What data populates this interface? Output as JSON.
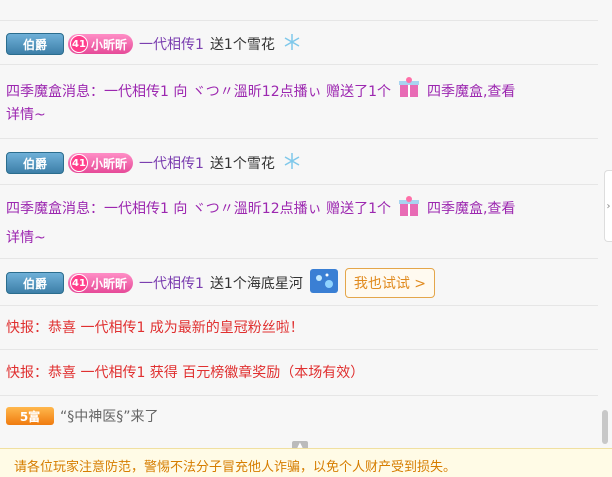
{
  "messages": [
    {
      "noble": "伯爵",
      "fan_level": "41",
      "fan_name": "小昕昕",
      "user": "一代相传1",
      "action": "送1个雪花",
      "gift_icon": "snowflake-icon"
    },
    {
      "text": "四季魔盒消息：一代相传1 向 ヾつ〃溫昕12点播ぃ 赠送了1个",
      "gift_icon": "gift-box-icon",
      "after": "四季魔盒,查看",
      "line2": "详情~"
    },
    {
      "noble": "伯爵",
      "fan_level": "41",
      "fan_name": "小昕昕",
      "user": "一代相传1",
      "action": "送1个雪花",
      "gift_icon": "snowflake-icon"
    },
    {
      "text": "四季魔盒消息：一代相传1 向 ヾつ〃溫昕12点播ぃ 赠送了1个",
      "gift_icon": "gift-box-icon",
      "after": "四季魔盒,查看",
      "line2": "详情~"
    },
    {
      "noble": "伯爵",
      "fan_level": "41",
      "fan_name": "小昕昕",
      "user": "一代相传1",
      "action": "送1个海底星河",
      "gift_icon": "ocean-stars-icon",
      "button": "我也试试 >"
    },
    {
      "text": "快报：恭喜 一代相传1 成为最新的皇冠粉丝啦！"
    },
    {
      "text": "快报：恭喜 一代相传1 获得 百元榜徽章奖励（本场有效）"
    },
    {
      "rich": "5富",
      "text": "“§中神医§”来了"
    }
  ],
  "notice": "请各位玩家注意防范，警惕不法分子冒充他人诈骗，以免个人财产受到损失。",
  "colors": {
    "purple": "#9c27b0",
    "red": "#e03030",
    "orange": "#d67d00"
  }
}
